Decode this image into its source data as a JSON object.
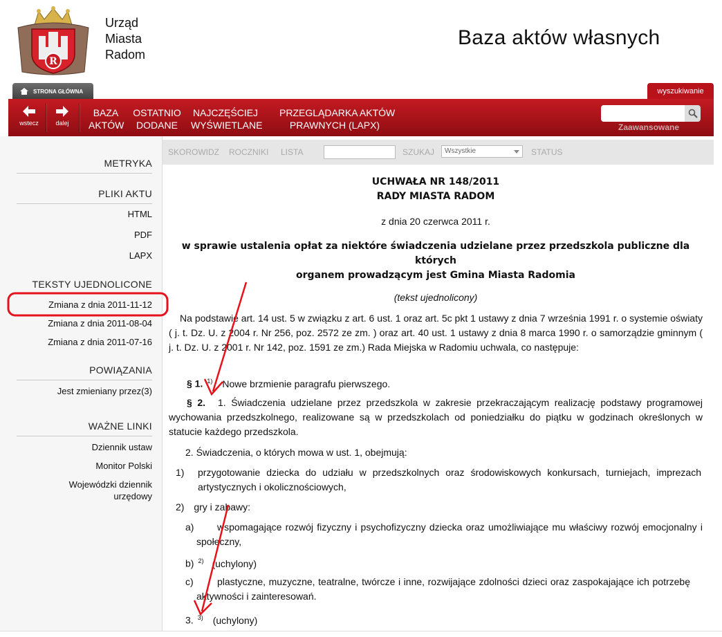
{
  "org": {
    "line1": "Urząd",
    "line2": "Miasta",
    "line3": "Radom"
  },
  "site_title": "Baza aktów własnych",
  "tabs": {
    "home": "STRONA GŁÓWNA",
    "search": "wyszukiwanie"
  },
  "nav": {
    "back": "wstecz",
    "forward": "dalej",
    "items": [
      {
        "l1": "BAZA",
        "l2": "AKTÓW"
      },
      {
        "l1": "OSTATNIO",
        "l2": "DODANE"
      },
      {
        "l1": "NAJCZĘŚCIEJ",
        "l2": "WYŚWIETLANE"
      },
      {
        "l1": "PRZEGLĄDARKA AKTÓW",
        "l2": "PRAWNYCH (LAPX)"
      }
    ],
    "advanced": "Zaawansowane"
  },
  "sidebar": {
    "metryka": "METRYKA",
    "pliki": "PLIKI AKTU",
    "files": [
      "HTML",
      "PDF",
      "LAPX"
    ],
    "teksty": "TEKSTY UJEDNOLICONE",
    "versions": [
      "Zmiana z dnia 2011-11-12",
      "Zmiana z dnia 2011-08-04",
      "Zmiana z dnia 2011-07-16"
    ],
    "powiazania": "POWIĄZANIA",
    "rel": "Jest zmieniany przez(3)",
    "linki": "WAŻNE LINKI",
    "links": [
      "Dziennik ustaw",
      "Monitor Polski",
      "Wojewódzki dziennik",
      "urzędowy"
    ]
  },
  "toolbar": {
    "skorowidz": "SKOROWIDZ",
    "roczniki": "ROCZNIKI",
    "lista": "LISTA",
    "szukaj": "SZUKAJ",
    "select": "Wszystkie",
    "status": "STATUS"
  },
  "doc": {
    "title1": "UCHWAŁA NR 148/2011",
    "title2": "RADY MIASTA RADOM",
    "date": "z dnia 20 czerwca 2011 r.",
    "subject1": "w sprawie ustalenia opłat za niektóre świadczenia udzielane przez przedszkola publiczne dla których",
    "subject2": "organem prowadzącym jest Gmina Miasta Radomia",
    "unified": "(tekst ujednolicony)",
    "preamble": "Na podstawie art. 14 ust. 5   w związku z   art. 6   ust. 1   oraz art. 5c pkt 1   ustawy z   dnia 7   września 1991 r. o   systemie oświaty ( j. t. Dz. U. z   2004 r. Nr 256, poz. 2572 ze zm. ) oraz art. 40 ust. 1   ustawy z   dnia 8 marca 1990 r. o   samorządzie gminnym ( j. t. Dz. U. z   2001 r. Nr 142, poz. 1591 ze zm.) Rada Miejska w Radomiu uchwala, co   następuje:",
    "p1_num": "§ 1.",
    "p1_sup": "1)",
    "p1_text": "Nowe brzmienie paragrafu pierwszego.",
    "p2_num": "§ 2.",
    "p2_text": "1.   Świadczenia udzielane przez przedszkola w   zakresie przekraczającym realizację podstawy programowej wychowania przedszkolnego, realizowane są w   przedszkolach od poniedziałku do piątku w   godzinach określonych w   statucie każdego przedszkola.",
    "p2_2": "2.   Świadczenia, o   których mowa w   ust. 1, obejmują:",
    "i1_num": "1)",
    "i1_text": "przygotowanie dziecka do udziału w   przedszkolnych oraz środowiskowych konkursach, turniejach, imprezach artystycznych i   okolicznościowych,",
    "i2_num": "2)",
    "i2_text": "gry i   zabawy:",
    "a_num": "a)",
    "a_text": "wspomagające rozwój fizyczny i   psychofizyczny dziecka oraz umożliwiające mu właściwy rozwój emocjonalny i   społeczny,",
    "b_num": "b)",
    "b_sup": "2)",
    "b_text": "(uchylony)",
    "c_num": "c)",
    "c_text": "plastyczne, muzyczne, teatralne, twórcze i   inne, rozwijające zdolności dzieci oraz zaspokajające ich potrzebę aktywności i   zainteresowań.",
    "p3_num": "3.",
    "p3_sup": "3)",
    "p3_text": "(uchylony)"
  },
  "colors": {
    "brand_red": "#b8121b",
    "annotation_red": "#e5121c"
  }
}
